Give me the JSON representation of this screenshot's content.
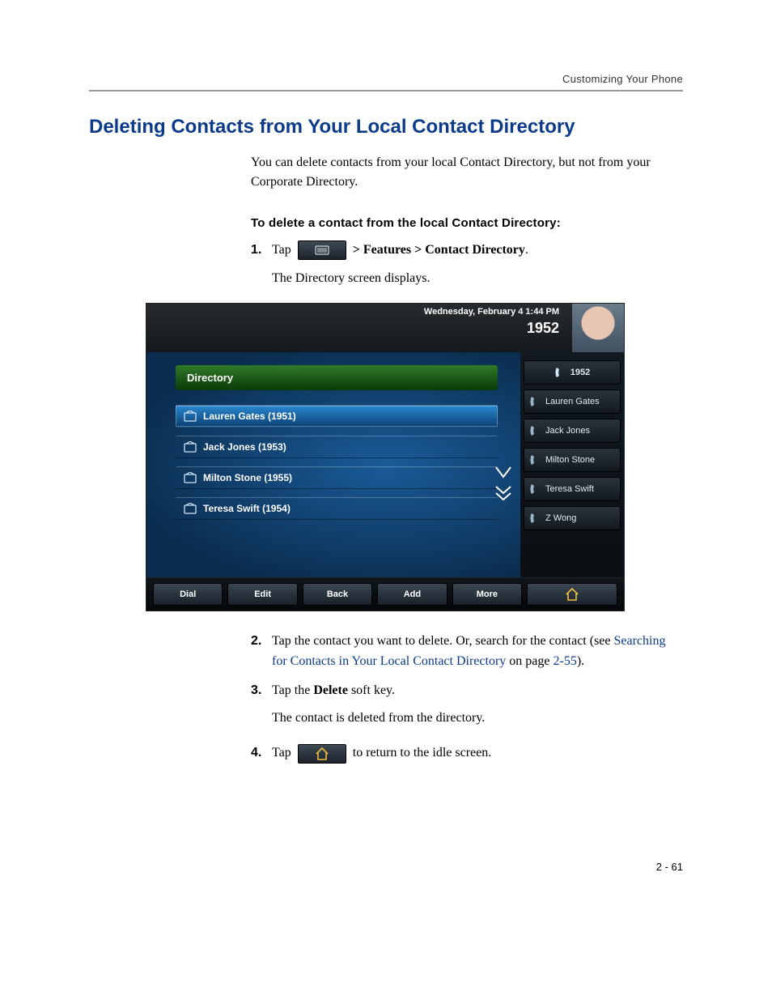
{
  "header": {
    "running_head": "Customizing Your Phone"
  },
  "section": {
    "title": "Deleting Contacts from Your Local Contact Directory"
  },
  "intro": "You can delete contacts from your local Contact Directory, but not from your Corporate Directory.",
  "procedure_heading": "To delete a contact from the local Contact Directory:",
  "steps": {
    "s1": {
      "num": "1.",
      "pre": "Tap ",
      "post_path": " > Features > Contact Directory",
      "tail": ".",
      "follow": "The Directory screen displays."
    },
    "s2": {
      "num": "2.",
      "text_a": "Tap the contact you want to delete. Or, search for the contact (see ",
      "link": "Searching for Contacts in Your Local Contact Directory",
      "text_b": " on page ",
      "pageref": "2-55",
      "text_c": ")."
    },
    "s3": {
      "num": "3.",
      "pre": "Tap the ",
      "strong": "Delete",
      "post": " soft key.",
      "follow": "The contact is deleted from the directory."
    },
    "s4": {
      "num": "4.",
      "pre": "Tap ",
      "post": " to return to the idle screen."
    }
  },
  "screenshot": {
    "datetime": "Wednesday, February 4  1:44 PM",
    "extension": "1952",
    "panel_title": "Directory",
    "contacts": [
      {
        "label": "Lauren Gates (1951)"
      },
      {
        "label": "Jack Jones (1953)"
      },
      {
        "label": "Milton Stone (1955)"
      },
      {
        "label": "Teresa Swift (1954)"
      }
    ],
    "side_items": [
      {
        "label": "1952",
        "type": "ext"
      },
      {
        "label": "Lauren Gates"
      },
      {
        "label": "Jack Jones"
      },
      {
        "label": "Milton Stone"
      },
      {
        "label": "Teresa Swift"
      },
      {
        "label": "Z Wong"
      }
    ],
    "softkeys": [
      "Dial",
      "Edit",
      "Back",
      "Add",
      "More"
    ]
  },
  "page_number": "2 - 61"
}
